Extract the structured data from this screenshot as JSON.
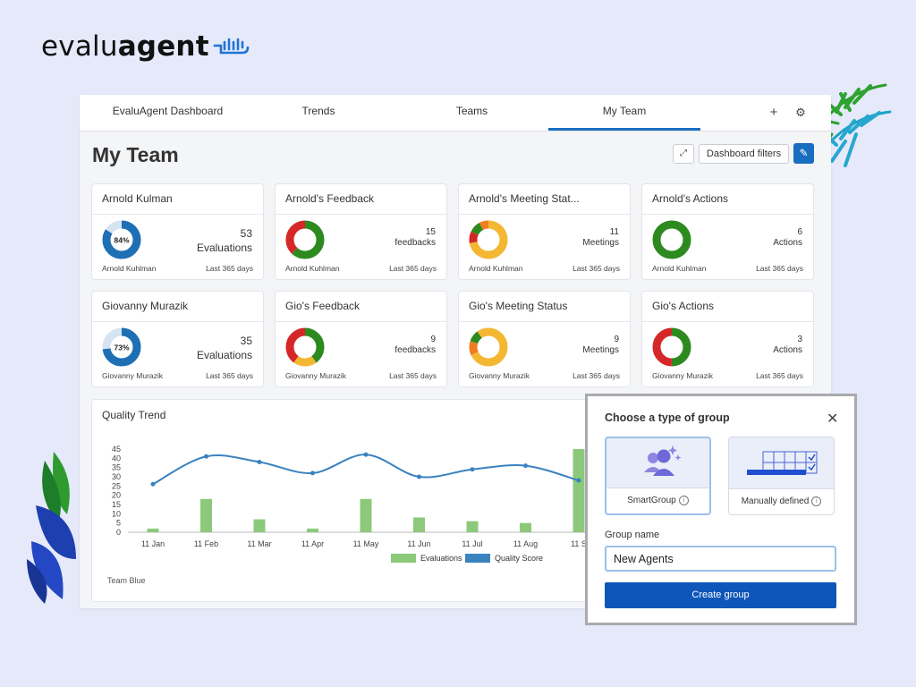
{
  "brand": {
    "name_light": "evalu",
    "name_bold": "agent"
  },
  "tabs": [
    {
      "label": "EvaluAgent Dashboard"
    },
    {
      "label": "Trends"
    },
    {
      "label": "Teams"
    },
    {
      "label": "My Team"
    }
  ],
  "header": {
    "title": "My Team",
    "filters_label": "Dashboard filters"
  },
  "cards": [
    {
      "title": "Arnold Kulman",
      "percent": 0.84,
      "percent_label": "84%",
      "value": "53",
      "unit": "Evaluations",
      "person": "Arnold Kuhlman",
      "period": "Last 365 days",
      "segments": []
    },
    {
      "title": "Arnold's Feedback",
      "value": "15",
      "unit": "feedbacks",
      "person": "Arnold Kuhlman",
      "period": "Last 365 days",
      "segments": [
        {
          "v": 0.62,
          "c": "#2d8a1f"
        },
        {
          "v": 0.38,
          "c": "#d62728"
        }
      ]
    },
    {
      "title": "Arnold's Meeting Stat...",
      "value": "11",
      "unit": "Meetings",
      "person": "Arnold Kuhlman",
      "period": "Last 365 days",
      "segments": [
        {
          "v": 0.72,
          "c": "#f4b731"
        },
        {
          "v": 0.1,
          "c": "#d62728"
        },
        {
          "v": 0.1,
          "c": "#2d8a1f"
        },
        {
          "v": 0.08,
          "c": "#f07c21"
        }
      ]
    },
    {
      "title": "Arnold's Actions",
      "value": "6",
      "unit": "Actions",
      "person": "Arnold Kuhlman",
      "period": "Last 365 days",
      "segments": [
        {
          "v": 1.0,
          "c": "#2d8a1f"
        }
      ]
    },
    {
      "title": "Giovanny Murazik",
      "percent": 0.73,
      "percent_label": "73%",
      "value": "35",
      "unit": "Evaluations",
      "person": "Giovanny Murazik",
      "period": "Last 365 days",
      "segments": []
    },
    {
      "title": "Gio's Feedback",
      "value": "9",
      "unit": "feedbacks",
      "person": "Giovanny Murazik",
      "period": "Last 365 days",
      "segments": [
        {
          "v": 0.4,
          "c": "#2d8a1f"
        },
        {
          "v": 0.2,
          "c": "#f4b731"
        },
        {
          "v": 0.4,
          "c": "#d62728"
        }
      ]
    },
    {
      "title": "Gio's Meeting Status",
      "value": "9",
      "unit": "Meetings",
      "person": "Giovanny Murazik",
      "period": "Last 365 days",
      "segments": [
        {
          "v": 0.68,
          "c": "#f4b731"
        },
        {
          "v": 0.12,
          "c": "#f07c21"
        },
        {
          "v": 0.1,
          "c": "#2d8a1f"
        },
        {
          "v": 0.1,
          "c": "#f4b731"
        }
      ]
    },
    {
      "title": "Gio's Actions",
      "value": "3",
      "unit": "Actions",
      "person": "Giovanny Murazik",
      "period": "Last 365 days",
      "segments": [
        {
          "v": 0.5,
          "c": "#2d8a1f"
        },
        {
          "v": 0.5,
          "c": "#d62728"
        }
      ]
    }
  ],
  "chart": {
    "title": "Quality Trend",
    "footer": "Team Blue"
  },
  "chart_data": {
    "type": "bar",
    "categories": [
      "11 Jan",
      "11 Feb",
      "11 Mar",
      "11 Apr",
      "11 May",
      "11 Jun",
      "11 Jul",
      "11 Aug",
      "11 S"
    ],
    "yticks": [
      0,
      5,
      10,
      15,
      20,
      25,
      30,
      35,
      40,
      45
    ],
    "ylim": [
      0,
      45
    ],
    "series": [
      {
        "name": "Evaluations",
        "type": "bar",
        "color": "#8cc97a",
        "values": [
          2,
          18,
          7,
          2,
          18,
          8,
          6,
          5,
          45
        ]
      },
      {
        "name": "Quality Score",
        "type": "line",
        "color": "#3a82c0",
        "values": [
          26,
          41,
          38,
          32,
          42,
          30,
          34,
          36,
          28
        ]
      }
    ],
    "legend": "bottom-center"
  },
  "modal": {
    "title": "Choose a type of group",
    "option_smart": "SmartGroup",
    "option_manual": "Manually defined",
    "group_label": "Group name",
    "group_value": "New Agents",
    "create_label": "Create group"
  }
}
